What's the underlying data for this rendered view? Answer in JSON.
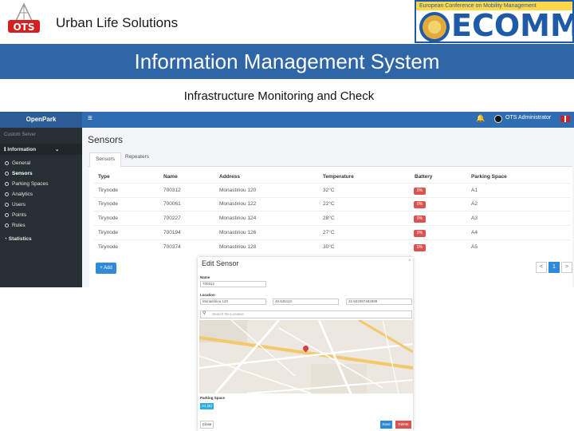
{
  "slide": {
    "company": "Urban Life Solutions",
    "logo_text": "OTS",
    "ecomm_tagline": "European Conference on Mobility Management",
    "ecomm_name": "ECOMM",
    "banner": "Information Management System",
    "subtitle": "Infrastructure Monitoring and Check"
  },
  "app": {
    "brand": "OpenPark",
    "user": "OTS Administrator",
    "sidebar": {
      "section_label": "Custom Server",
      "group": "Information",
      "items": [
        "General",
        "Sensors",
        "Parking Spaces",
        "Analytics",
        "Users",
        "Points",
        "Rules"
      ],
      "statistics": "Statistics"
    },
    "page_title": "Sensors",
    "tabs": [
      "Sensors",
      "Repeaters"
    ],
    "table": {
      "headers": [
        "Type",
        "Name",
        "Address",
        "Temperature",
        "Battery",
        "Parking Space"
      ],
      "rows": [
        [
          "Tirynode",
          "700312",
          "Monastiriou 120",
          "32°C",
          "0%",
          "A1"
        ],
        [
          "Tirynode",
          "700061",
          "Monastiriou 122",
          "22°C",
          "0%",
          "A2"
        ],
        [
          "Tirynode",
          "700227",
          "Monastiriou 124",
          "28°C",
          "0%",
          "A3"
        ],
        [
          "Tirynode",
          "700194",
          "Monastiriou 126",
          "27°C",
          "0%",
          "A4"
        ],
        [
          "Tirynode",
          "700374",
          "Monastiriou 128",
          "30°C",
          "0%",
          "A5"
        ]
      ]
    },
    "add_label": "+ Add",
    "pagination": [
      "<",
      "1",
      ">"
    ]
  },
  "modal": {
    "title": "Edit Sensor",
    "close": "×",
    "name_label": "Name",
    "name_value": "700312",
    "location_label": "Location",
    "address_value": "Monastiriou 120",
    "lat_value": "40.645113",
    "lng_value": "22.922087482899",
    "search_placeholder": "Search the Location",
    "parking_label": "Parking Space",
    "parking_value": "A1 (B)",
    "close_btn": "Close",
    "save_btn": "Save",
    "delete_btn": "Delete"
  },
  "colors": {
    "banner": "#2f66a8",
    "topbar": "#2f6db2",
    "sidebar": "#262f33",
    "primary": "#2f8ad8",
    "danger": "#d9534f"
  }
}
